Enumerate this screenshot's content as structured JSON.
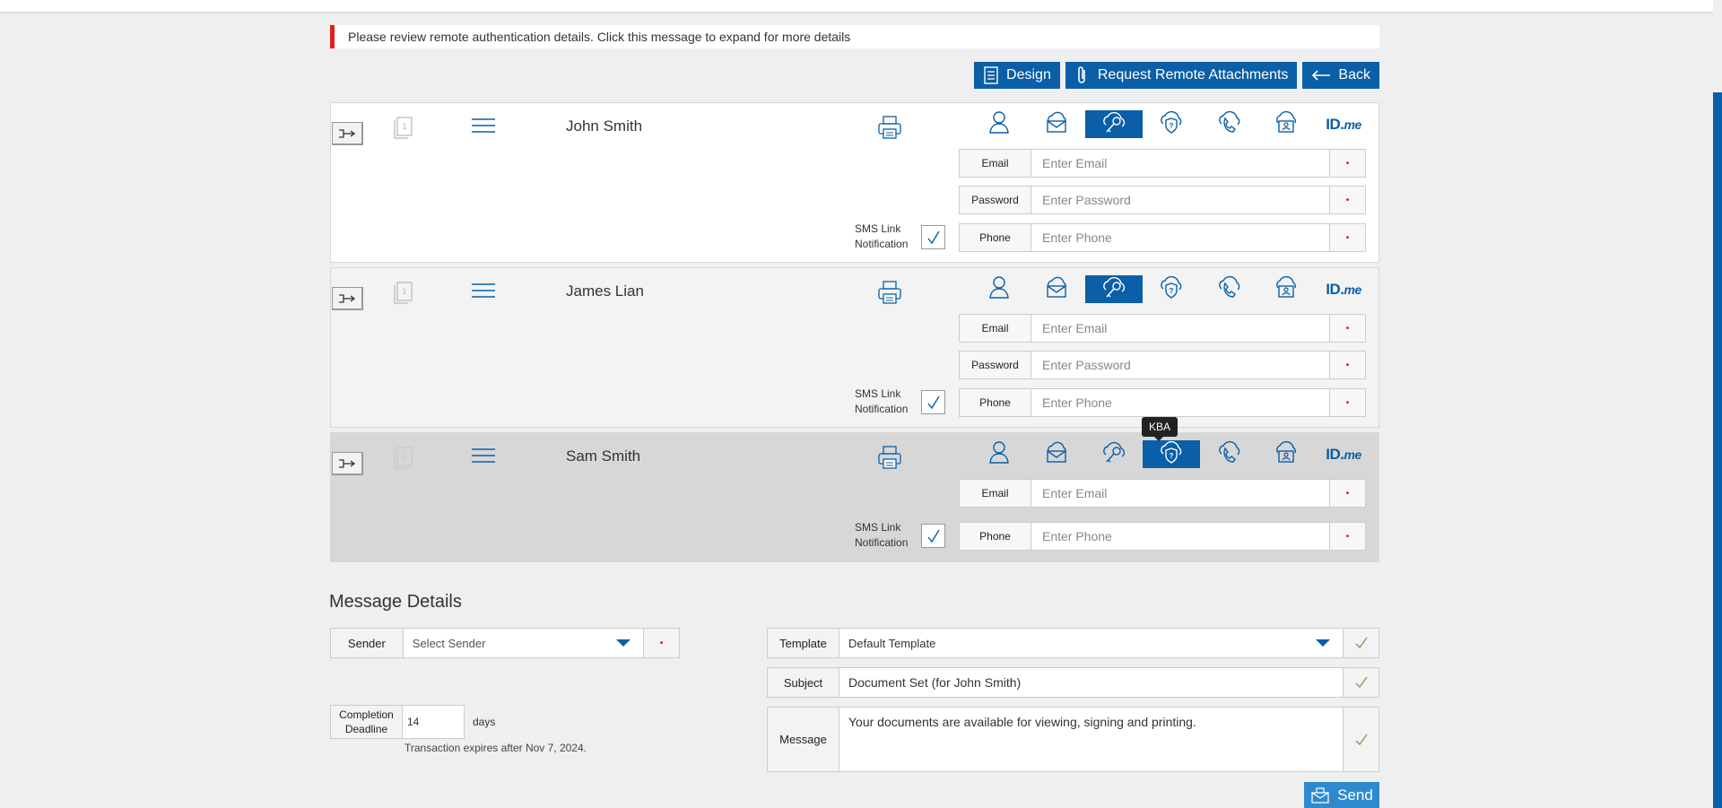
{
  "notice": "Please review remote authentication details. Click this message to expand for more details",
  "actions": {
    "design": "Design",
    "request_attachments": "Request Remote Attachments",
    "back": "Back"
  },
  "doc_count": "1",
  "signers": [
    {
      "name": "John Smith",
      "active_auth": "password",
      "fields": [
        {
          "label": "Email",
          "placeholder": "Enter Email"
        },
        {
          "label": "Password",
          "placeholder": "Enter Password"
        },
        {
          "label": "Phone",
          "placeholder": "Enter Phone"
        }
      ],
      "sms_label_line1": "SMS Link",
      "sms_label_line2": "Notification",
      "sms_checked": true
    },
    {
      "name": "James Lian",
      "active_auth": "password",
      "fields": [
        {
          "label": "Email",
          "placeholder": "Enter Email"
        },
        {
          "label": "Password",
          "placeholder": "Enter Password"
        },
        {
          "label": "Phone",
          "placeholder": "Enter Phone"
        }
      ],
      "sms_label_line1": "SMS Link",
      "sms_label_line2": "Notification",
      "sms_checked": true
    },
    {
      "name": "Sam Smith",
      "active_auth": "kba",
      "tooltip": "KBA",
      "fields": [
        {
          "label": "Email",
          "placeholder": "Enter Email"
        },
        {
          "label": "Phone",
          "placeholder": "Enter Phone"
        }
      ],
      "sms_label_line1": "SMS Link",
      "sms_label_line2": "Notification",
      "sms_checked": true
    }
  ],
  "auth_icons": [
    "person-icon",
    "email-cloud-icon",
    "password-key-icon",
    "kba-shield-icon",
    "phone-icon",
    "id-cloud-icon",
    "idme-logo"
  ],
  "idme": {
    "main": "ID.",
    "suffix": "me"
  },
  "required_mark": "•",
  "message_details": {
    "title": "Message Details",
    "sender_label": "Sender",
    "sender_value": "Select Sender",
    "template_label": "Template",
    "template_value": "Default Template",
    "subject_label": "Subject",
    "subject_value": "Document Set (for John Smith)",
    "message_label": "Message",
    "message_value": "Your documents are available for viewing, signing and printing.",
    "deadline_label_line1": "Completion",
    "deadline_label_line2": "Deadline",
    "deadline_value": "14",
    "days_label": "days",
    "expires_text": "Transaction expires after Nov 7, 2024.",
    "send_label": "Send"
  },
  "colors": {
    "accent": "#0a5fa8",
    "alert": "#e02020",
    "send": "#2e8ad0",
    "check": "#7aa060"
  }
}
